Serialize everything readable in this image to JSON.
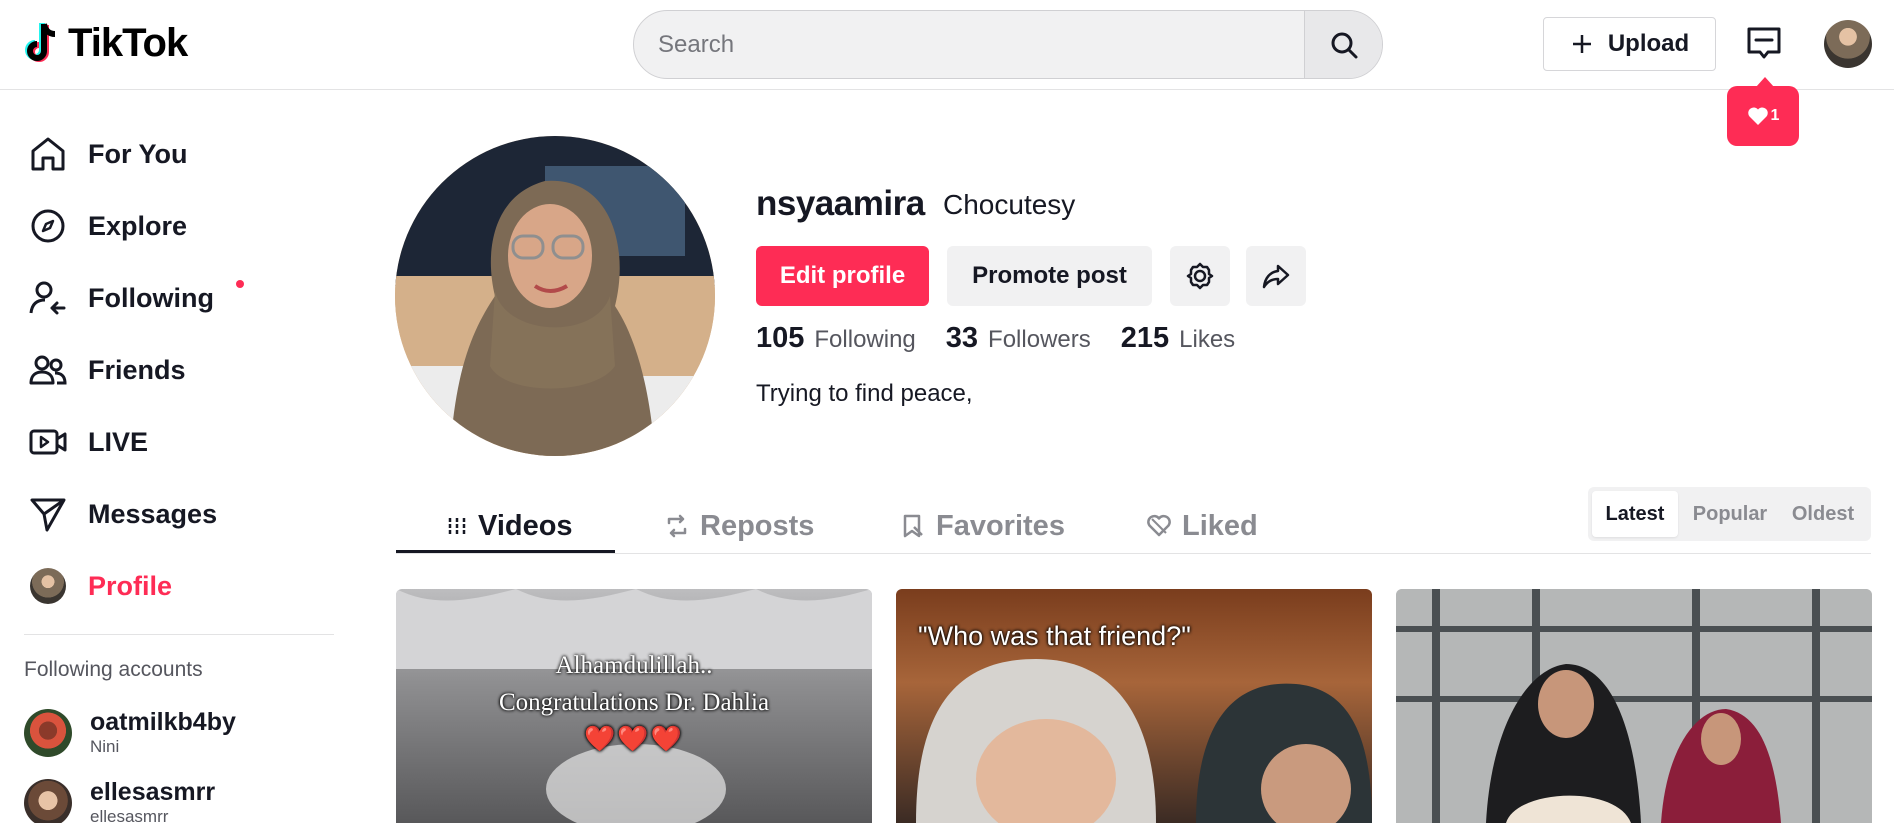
{
  "header": {
    "logo_text": "TikTok",
    "search_placeholder": "Search",
    "upload_label": "Upload",
    "notification_count": "1"
  },
  "sidebar": {
    "items": [
      {
        "label": "For You",
        "icon": "home-icon"
      },
      {
        "label": "Explore",
        "icon": "compass-icon"
      },
      {
        "label": "Following",
        "icon": "user-follow-icon"
      },
      {
        "label": "Friends",
        "icon": "friends-icon"
      },
      {
        "label": "LIVE",
        "icon": "live-icon"
      },
      {
        "label": "Messages",
        "icon": "send-icon"
      },
      {
        "label": "Profile",
        "icon": "avatar"
      }
    ],
    "following_title": "Following accounts",
    "accounts": [
      {
        "name": "oatmilkb4by",
        "sub": "Nini"
      },
      {
        "name": "ellesasmrr",
        "sub": "ellesasmrr"
      }
    ]
  },
  "profile": {
    "username": "nsyaamira",
    "nickname": "Chocutesy",
    "edit_label": "Edit profile",
    "promote_label": "Promote post",
    "stats": [
      {
        "value": "105",
        "label": "Following"
      },
      {
        "value": "33",
        "label": "Followers"
      },
      {
        "value": "215",
        "label": "Likes"
      }
    ],
    "bio": "Trying to find peace,"
  },
  "tabs": [
    {
      "label": "Videos",
      "icon": "grid-icon",
      "active": true
    },
    {
      "label": "Reposts",
      "icon": "repost-icon",
      "active": false
    },
    {
      "label": "Favorites",
      "icon": "bookmark-icon",
      "active": false
    },
    {
      "label": "Liked",
      "icon": "heart-icon",
      "active": false
    }
  ],
  "sort": [
    "Latest",
    "Popular",
    "Oldest"
  ],
  "videos": [
    {
      "caption_line1": "Alhamdulillah..",
      "caption_line2": "Congratulations Dr. Dahlia",
      "emoji": "❤️❤️❤️"
    },
    {
      "caption_line1": "\"Who was that friend?\""
    },
    {
      "caption_line1": ""
    }
  ],
  "colors": {
    "accent": "#fe2c55",
    "text": "#161823",
    "muted": "#55565e"
  }
}
